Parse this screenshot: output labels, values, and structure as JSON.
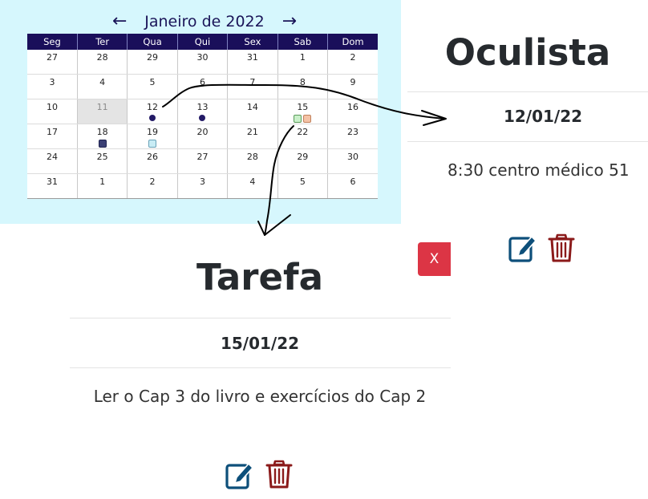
{
  "calendar": {
    "prev_icon": "arrow-left-icon",
    "next_icon": "arrow-right-icon",
    "month_title": "Janeiro de 2022",
    "weekdays": [
      "Seg",
      "Ter",
      "Qua",
      "Qui",
      "Sex",
      "Sab",
      "Dom"
    ],
    "weeks": [
      [
        "27",
        "28",
        "29",
        "30",
        "31",
        "1",
        "2"
      ],
      [
        "3",
        "4",
        "5",
        "6",
        "7",
        "8",
        "9"
      ],
      [
        "10",
        "11",
        "12",
        "13",
        "14",
        "15",
        "16"
      ],
      [
        "17",
        "18",
        "19",
        "20",
        "21",
        "22",
        "23"
      ],
      [
        "24",
        "25",
        "26",
        "27",
        "28",
        "29",
        "30"
      ],
      [
        "31",
        "1",
        "2",
        "3",
        "4",
        "5",
        "6"
      ]
    ],
    "highlighted_day": "11",
    "markers": [
      {
        "week": 2,
        "day": 2,
        "shape": "circle",
        "color": "#231a66"
      },
      {
        "week": 2,
        "day": 3,
        "shape": "circle",
        "color": "#231a66"
      },
      {
        "week": 2,
        "day": 5,
        "shape": "square",
        "color": "#c9f0c9",
        "border": "#5a9a5a"
      },
      {
        "week": 2,
        "day": 5,
        "shape": "square",
        "color": "#f4c2a6",
        "border": "#c0805a"
      },
      {
        "week": 3,
        "day": 1,
        "shape": "square",
        "color": "#3a3f73",
        "border": "#1f2350"
      },
      {
        "week": 3,
        "day": 2,
        "shape": "square",
        "color": "#c8ecf5",
        "border": "#6aa2b8"
      }
    ]
  },
  "event_oculista": {
    "title": "Oculista",
    "date": "12/01/22",
    "description": "8:30 centro médico 51",
    "edit_icon": "edit-icon",
    "delete_icon": "trash-icon"
  },
  "close_button": {
    "label": "X",
    "color": "#dc3545"
  },
  "event_tarefa": {
    "title": "Tarefa",
    "date": "15/01/22",
    "description": "Ler o Cap 3 do livro e exercícios do Cap 2",
    "edit_icon": "edit-icon",
    "delete_icon": "trash-icon"
  },
  "colors": {
    "calendar_bg": "#d6f7fd",
    "calendar_header": "#1a0f5a",
    "edit_icon": "#0d4f7a",
    "delete_icon": "#8b1a1a"
  }
}
